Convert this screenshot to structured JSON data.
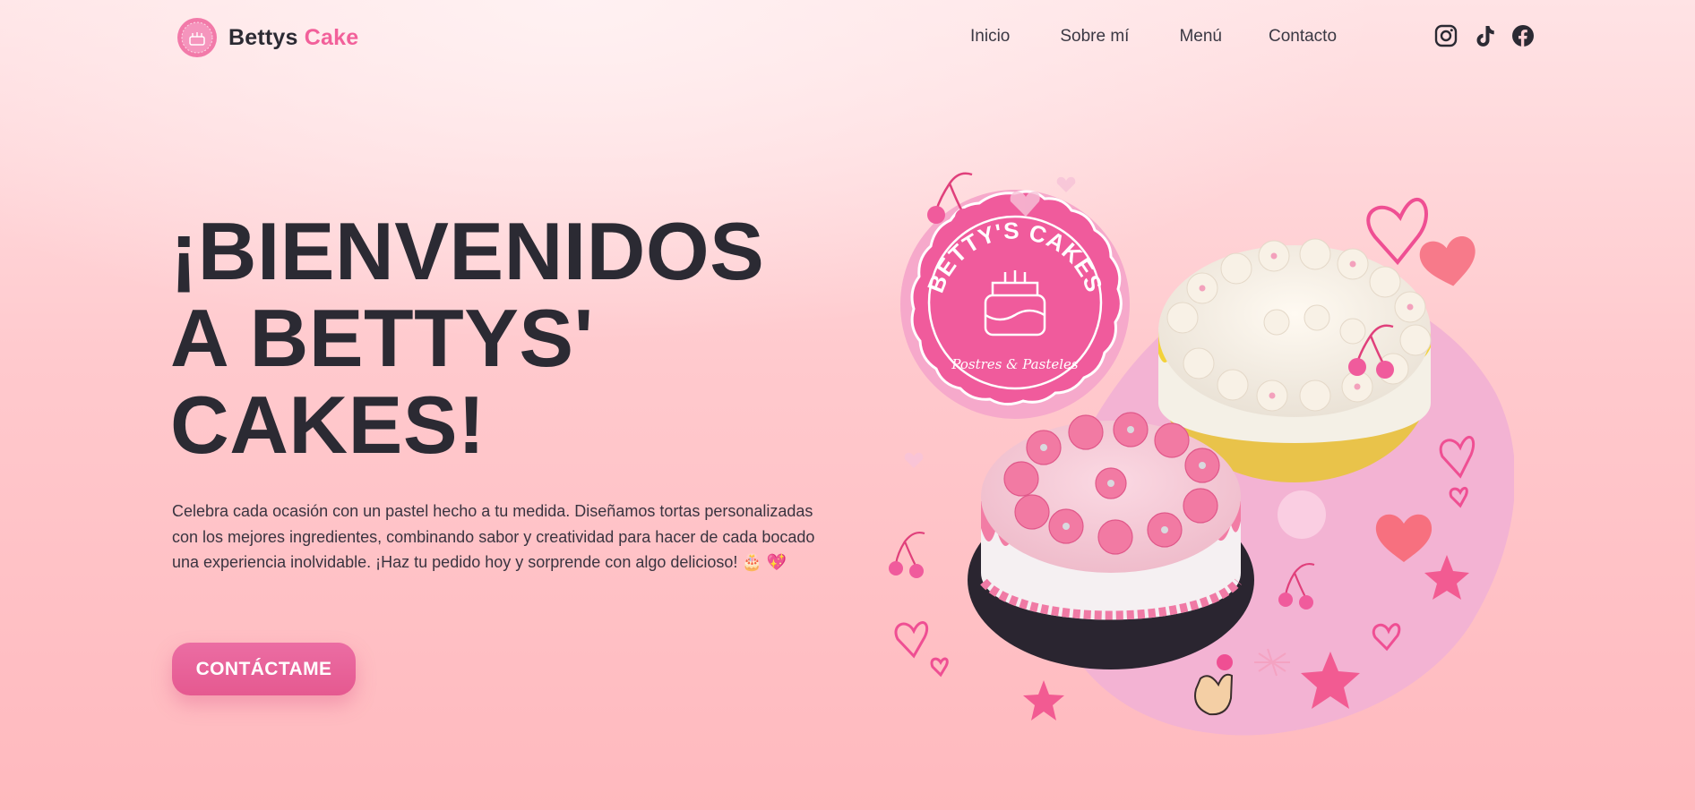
{
  "brand": {
    "name_part1": "Bettys",
    "name_part2": "Cake",
    "accent_color": "#f2609a"
  },
  "nav": {
    "items": [
      {
        "label": "Inicio"
      },
      {
        "label": "Sobre mí"
      },
      {
        "label": "Menú"
      },
      {
        "label": "Contacto"
      }
    ]
  },
  "social": [
    {
      "icon": "instagram-icon"
    },
    {
      "icon": "tiktok-icon"
    },
    {
      "icon": "facebook-icon"
    }
  ],
  "hero": {
    "title_line1": "¡BIENVENIDOS",
    "title_line2": "A BETTYS'",
    "title_line3": "CAKES!",
    "description": "Celebra cada ocasión con un pastel hecho a tu medida. Diseñamos tortas personalizadas con los mejores ingredientes, combinando sabor y creatividad para hacer de cada bocado una experiencia inolvidable. ¡Haz tu pedido hoy y sorprende con algo delicioso! 🎂 💖",
    "cta_label": "CONTÁCTAME",
    "cta_color": "#e55990"
  },
  "illustration": {
    "badge_title": "BETTY'S CAKES",
    "badge_subtitle": "Postres & Pasteles",
    "badge_color": "#f05b9c"
  }
}
